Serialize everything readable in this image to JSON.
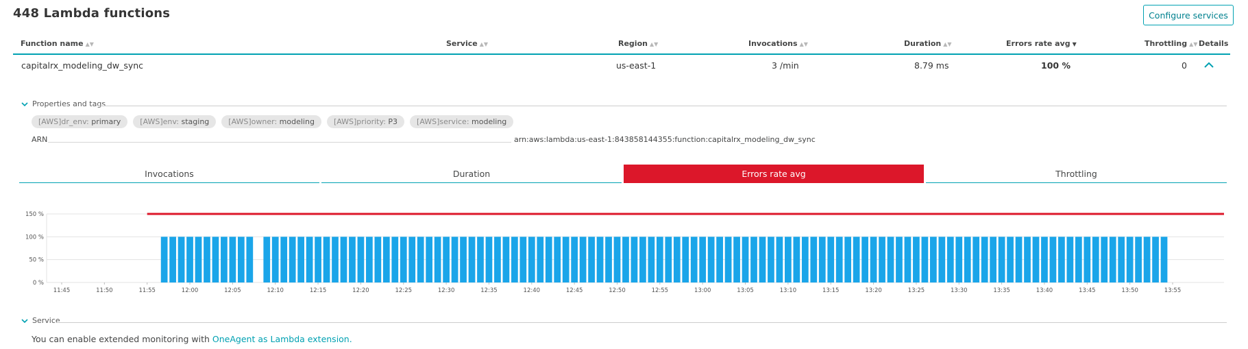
{
  "page": {
    "title": "448 Lambda functions",
    "configure_label": "Configure services"
  },
  "table": {
    "headers": {
      "function_name": "Function name",
      "service": "Service",
      "region": "Region",
      "invocations": "Invocations",
      "duration": "Duration",
      "errors_rate": "Errors rate avg",
      "throttling": "Throttling",
      "details": "Details"
    },
    "row": {
      "function_name": "capitalrx_modeling_dw_sync",
      "region": "us-east-1",
      "invocations": "3 /min",
      "duration": "8.79 ms",
      "errors_rate": "100 %",
      "throttling": "0"
    }
  },
  "properties": {
    "title": "Properties and tags",
    "tags": [
      {
        "key": "[AWS]dr_env:",
        "value": "primary"
      },
      {
        "key": "[AWS]env:",
        "value": "staging"
      },
      {
        "key": "[AWS]owner:",
        "value": "modeling"
      },
      {
        "key": "[AWS]priority:",
        "value": "P3"
      },
      {
        "key": "[AWS]service:",
        "value": "modeling"
      }
    ],
    "arn_label": "ARN",
    "arn_value": "arn:aws:lambda:us-east-1:843858144355:function:capitalrx_modeling_dw_sync"
  },
  "tabs": [
    "Invocations",
    "Duration",
    "Errors rate avg",
    "Throttling"
  ],
  "active_tab": "Errors rate avg",
  "chart_data": {
    "type": "bar",
    "ylabel": "",
    "y_ticks": [
      "0 %",
      "50 %",
      "100 %",
      "150 %"
    ],
    "ylim": [
      0,
      150
    ],
    "x_tick_labels": [
      "11:45",
      "11:50",
      "11:55",
      "12:00",
      "12:05",
      "12:10",
      "12:15",
      "12:20",
      "12:25",
      "12:30",
      "12:35",
      "12:40",
      "12:45",
      "12:50",
      "12:55",
      "13:00",
      "13:05",
      "13:10",
      "13:15",
      "13:20",
      "13:25",
      "13:30",
      "13:35",
      "13:40",
      "13:45",
      "13:50",
      "13:55"
    ],
    "series": [
      {
        "values_description": "per-minute error rate",
        "value": 100,
        "start": "11:57",
        "end": "13:54",
        "gap": "12:08"
      }
    ],
    "threshold": {
      "value": 150,
      "start": "11:55",
      "end": "13:55"
    },
    "colors": {
      "bar": "#1aa5e9",
      "threshold": "#dc172a",
      "grid": "#e3e3e3"
    }
  },
  "service": {
    "title": "Service",
    "text_prefix": "You can enable extended monitoring with ",
    "link": "OneAgent as Lambda extension."
  },
  "colors": {
    "accent": "#00a1b2",
    "active_tab": "#dc172a"
  }
}
